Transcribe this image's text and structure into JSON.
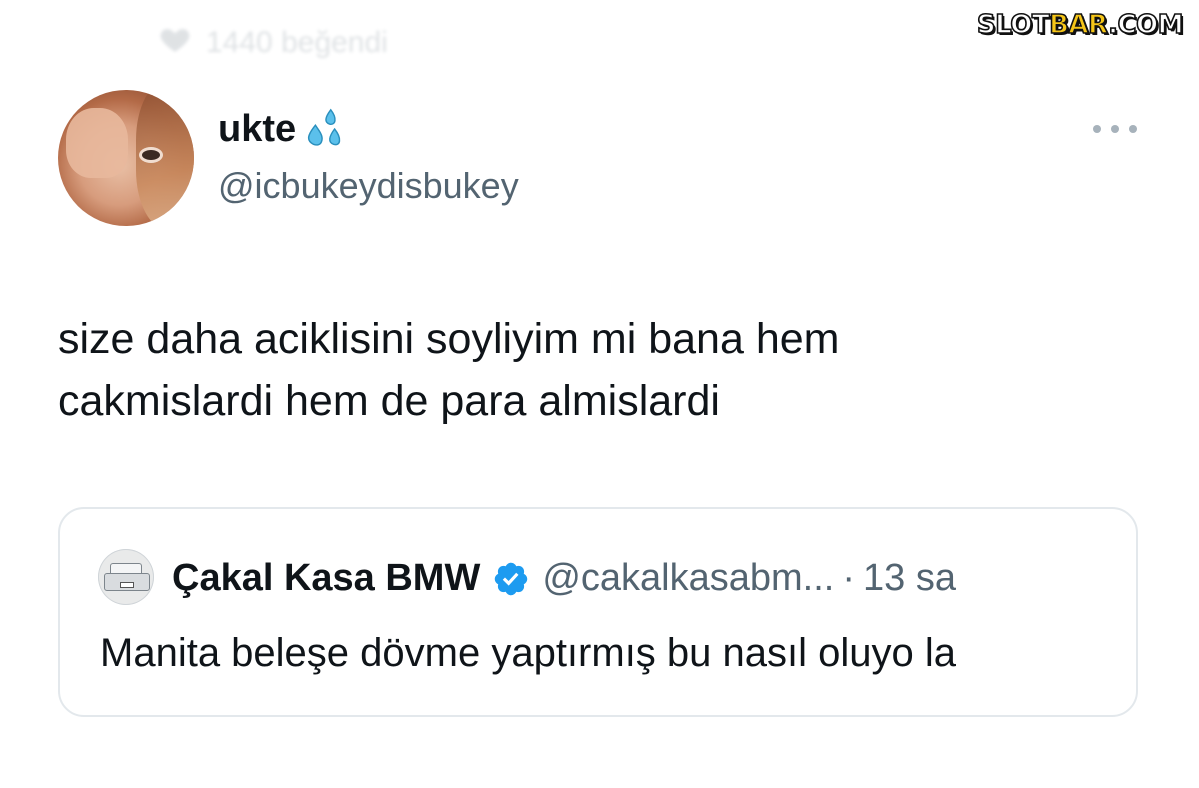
{
  "context": {
    "text": "1440 beğendi",
    "icon": "heart-icon"
  },
  "watermark": {
    "part1": "SLOT",
    "part2": "BAR",
    "part3": ".COM"
  },
  "tweet": {
    "display_name": "ukte",
    "name_emoji": "sweat-droplets-icon",
    "handle": "@icbukeydisbukey",
    "text_line1": "size daha aciklisini soyliyim mi bana hem",
    "text_line2": "cakmislardi hem de para almislardi",
    "more_icon": "more-horizontal-icon"
  },
  "quote": {
    "display_name": "Çakal Kasa BMW",
    "verified_icon": "verified-badge-icon",
    "handle": "@cakalkasabm...",
    "separator": "·",
    "time": "13 sa",
    "text": "Manita beleşe dövme yaptırmış bu nasıl oluyo la"
  },
  "colors": {
    "text_primary": "#0f1419",
    "text_secondary": "#536471",
    "verified_blue": "#1d9bf0",
    "card_border": "#e3e8ec",
    "emoji_blue": "#5bc0eb"
  }
}
